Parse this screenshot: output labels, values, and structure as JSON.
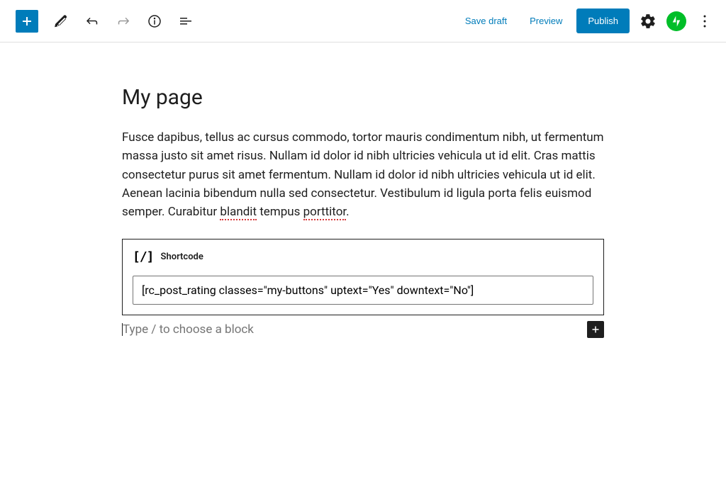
{
  "toolbar": {
    "save_draft": "Save draft",
    "preview": "Preview",
    "publish": "Publish"
  },
  "editor": {
    "title": "My page",
    "paragraph_parts": {
      "p1": "Fusce dapibus, tellus ac cursus commodo, tortor mauris condimentum nibh, ut fermentum massa justo sit amet risus. Nullam id dolor id nibh ultricies vehicula ut id elit. Cras mattis consectetur purus sit amet fermentum. Nullam id dolor id nibh ultricies vehicula ut id elit. Aenean lacinia bibendum nulla sed consectetur. Vestibulum id ligula porta felis euismod semper. Curabitur ",
      "err1": "blandit",
      "p2": " tempus ",
      "err2": "porttitor",
      "p3": "."
    },
    "shortcode": {
      "label": "Shortcode",
      "value": "[rc_post_rating classes=\"my-buttons\" uptext=\"Yes\" downtext=\"No\"]"
    },
    "block_placeholder": "Type / to choose a block"
  }
}
